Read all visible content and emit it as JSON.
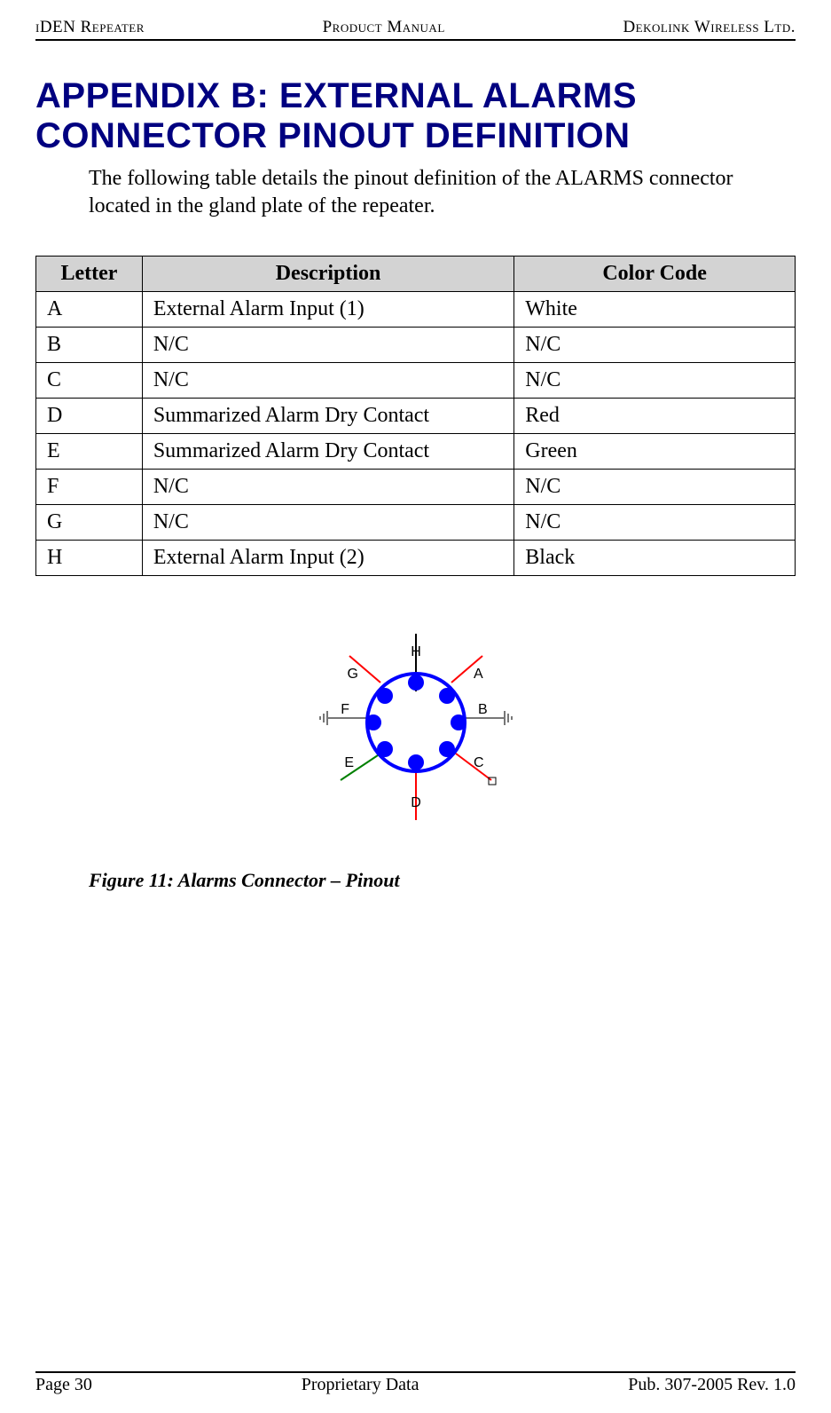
{
  "header": {
    "left": "iDEN Repeater",
    "center": "Product Manual",
    "right": "Dekolink Wireless Ltd."
  },
  "title_line1": "APPENDIX B: EXTERNAL ALARMS",
  "title_line2": "CONNECTOR PINOUT DEFINITION",
  "intro": "The following table details the pinout definition of the ALARMS connector located in the gland plate of the repeater.",
  "table": {
    "headers": {
      "col1": "Letter",
      "col2": "Description",
      "col3": "Color Code"
    },
    "rows": [
      {
        "letter": "A",
        "desc": "External Alarm Input (1)",
        "color": "White"
      },
      {
        "letter": "B",
        "desc": "N/C",
        "color": "N/C"
      },
      {
        "letter": "C",
        "desc": "N/C",
        "color": "N/C"
      },
      {
        "letter": "D",
        "desc": "Summarized Alarm Dry Contact",
        "color": "Red"
      },
      {
        "letter": "E",
        "desc": "Summarized Alarm Dry Contact",
        "color": "Green"
      },
      {
        "letter": "F",
        "desc": "N/C",
        "color": "N/C"
      },
      {
        "letter": "G",
        "desc": "N/C",
        "color": "N/C"
      },
      {
        "letter": "H",
        "desc": "External Alarm Input (2)",
        "color": "Black"
      }
    ]
  },
  "figure": {
    "caption": "Figure 11: Alarms Connector – Pinout",
    "pins": {
      "A": "A",
      "B": "B",
      "C": "C",
      "D": "D",
      "E": "E",
      "F": "F",
      "G": "G",
      "H": "H"
    }
  },
  "footer": {
    "left": "Page 30",
    "center": "Proprietary Data",
    "right": "Pub. 307-2005 Rev. 1.0"
  }
}
